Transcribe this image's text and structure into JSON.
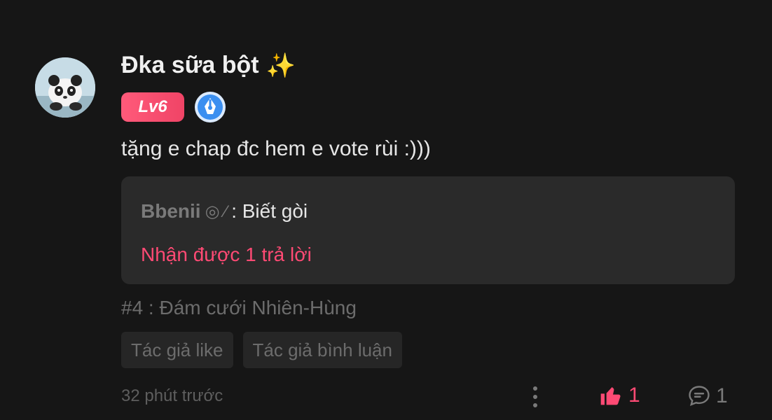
{
  "comment": {
    "username": "Đka sữa bột",
    "username_emoji": "✨",
    "level": "Lv6",
    "text": "tặng e chap đc hem e vote rùi :)))",
    "reply_preview": {
      "author": "Bbenii",
      "author_decor": "◎ ⁄",
      "text": ": Biết gòi",
      "replies_label": "Nhận được 1 trả lời"
    },
    "chapter": "#4 : Đám cưới Nhiên-Hùng",
    "tags": [
      "Tác giả like",
      "Tác giả bình luận"
    ],
    "time": "32 phút trước",
    "like_count": "1",
    "reply_count": "1"
  },
  "colors": {
    "accent": "#ff4a74",
    "background": "#161616",
    "card": "#2a2a2a",
    "level_badge": "#f04466",
    "pen_badge": "#3b8ff0"
  },
  "icons": [
    "avatar-panda",
    "sparkles-icon",
    "pen-badge-icon",
    "more-vertical-icon",
    "thumbs-up-icon",
    "comment-bubble-icon"
  ]
}
